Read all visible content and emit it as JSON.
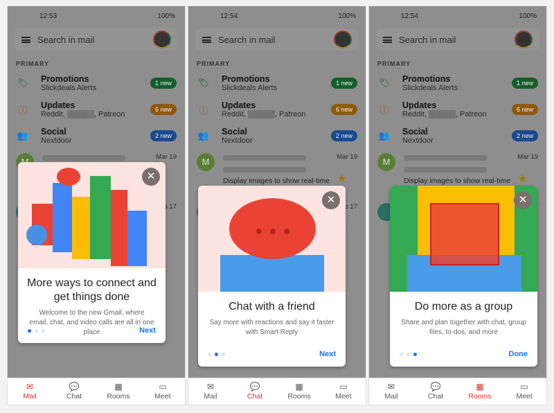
{
  "common": {
    "search_placeholder": "Search in mail",
    "section": "PRIMARY",
    "categories": [
      {
        "title": "Promotions",
        "sub": "Slickdeals Alerts",
        "badge": "1 new",
        "color": "#188038"
      },
      {
        "title": "Updates",
        "sub": "Reddit, ▒▒▒▒▒, Patreon",
        "badge": "6 new",
        "color": "#e37400"
      },
      {
        "title": "Social",
        "sub": "Nextdoor",
        "badge": "2 new",
        "color": "#1967d2"
      }
    ],
    "mail": {
      "avatar": "M",
      "date": "Mar 19",
      "preview": "Display images to show real-time c...",
      "date2": "Feb 17"
    },
    "battery": "100%",
    "nav": [
      "Mail",
      "Chat",
      "Rooms",
      "Meet"
    ],
    "close": "✕"
  },
  "panels": [
    {
      "time": "12:53",
      "title": "More ways to connect and get things done",
      "desc": "Welcome to the new Gmail, where email, chat, and video calls are all in one place",
      "action": "Next",
      "active_tab": "Mail",
      "page": 1
    },
    {
      "time": "12:54",
      "title": "Chat with a friend",
      "desc": "Say more with reactions and say it faster with Smart Reply",
      "action": "Next",
      "active_tab": "Chat",
      "page": 2
    },
    {
      "time": "12:54",
      "title": "Do more as a group",
      "desc": "Share and plan together with chat, group files, to-dos, and more",
      "action": "Done",
      "active_tab": "Rooms",
      "page": 3
    }
  ]
}
